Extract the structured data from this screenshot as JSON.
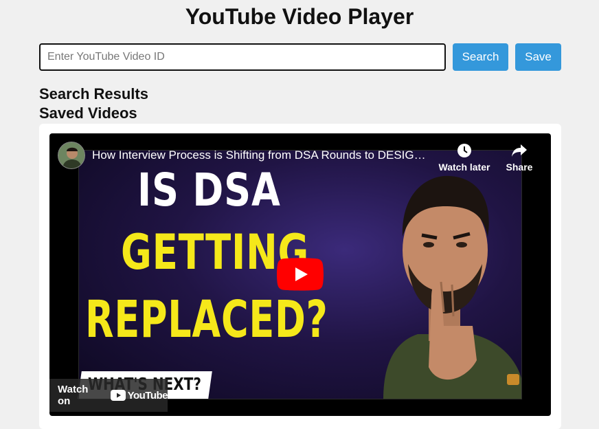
{
  "page": {
    "title": "YouTube Video Player"
  },
  "search": {
    "placeholder": "Enter YouTube Video ID",
    "value": "",
    "search_label": "Search",
    "save_label": "Save"
  },
  "sections": {
    "results_heading": "Search Results",
    "saved_heading": "Saved Videos"
  },
  "player": {
    "video_title": "How Interview Process is Shifting from DSA Rounds to DESIGN Rounds",
    "watch_later_label": "Watch later",
    "share_label": "Share",
    "watch_on_label": "Watch on",
    "youtube_label": "YouTube",
    "thumbnail_text": {
      "line1": "IS DSA",
      "line2": "GETTING",
      "line3": "REPLACED?",
      "banner": "WHAT'S NEXT?"
    }
  },
  "colors": {
    "accent": "#3498db",
    "youtube_red": "#ff0000",
    "thumbnail_yellow": "#f5e81a",
    "background": "#f0f0f0"
  },
  "icons": {
    "watch_later": "clock-icon",
    "share": "share-arrow-icon",
    "play": "youtube-play-icon",
    "logo": "youtube-logo-icon"
  }
}
